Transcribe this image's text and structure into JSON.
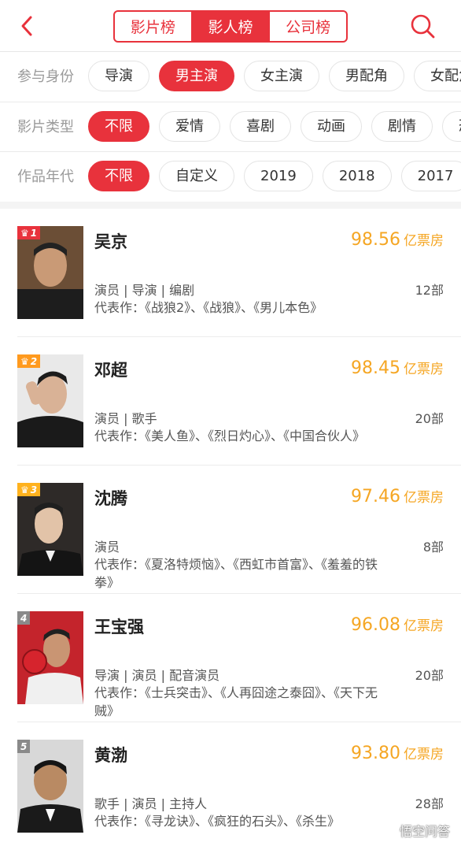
{
  "header": {
    "tabs": [
      {
        "label": "影片榜",
        "active": false
      },
      {
        "label": "影人榜",
        "active": true
      },
      {
        "label": "公司榜",
        "active": false
      }
    ]
  },
  "filters": [
    {
      "label": "参与身份",
      "options": [
        "导演",
        "男主演",
        "女主演",
        "男配角",
        "女配角"
      ],
      "selected": 1
    },
    {
      "label": "影片类型",
      "options": [
        "不限",
        "爱情",
        "喜剧",
        "动画",
        "剧情",
        "恐怖"
      ],
      "selected": 0
    },
    {
      "label": "作品年代",
      "options": [
        "不限",
        "自定义",
        "2019",
        "2018",
        "2017"
      ],
      "selected": 0
    }
  ],
  "list": [
    {
      "rank": "1",
      "name": "吴京",
      "score": "98.56",
      "unit": "亿票房",
      "roles": "演员 | 导演 | 编剧",
      "count": "12部",
      "works": "代表作：《战狼2》、《战狼》、《男儿本色》"
    },
    {
      "rank": "2",
      "name": "邓超",
      "score": "98.45",
      "unit": "亿票房",
      "roles": "演员 | 歌手",
      "count": "20部",
      "works": "代表作：《美人鱼》、《烈日灼心》、《中国合伙人》"
    },
    {
      "rank": "3",
      "name": "沈腾",
      "score": "97.46",
      "unit": "亿票房",
      "roles": "演员",
      "count": "8部",
      "works": "代表作：《夏洛特烦恼》、《西虹市首富》、《羞羞的铁拳》"
    },
    {
      "rank": "4",
      "name": "王宝强",
      "score": "96.08",
      "unit": "亿票房",
      "roles": "导演 | 演员 | 配音演员",
      "count": "20部",
      "works": "代表作：《士兵突击》、《人再囧途之泰囧》、《天下无贼》"
    },
    {
      "rank": "5",
      "name": "黄渤",
      "score": "93.80",
      "unit": "亿票房",
      "roles": "歌手 | 演员 | 主持人",
      "count": "28部",
      "works": "代表作：《寻龙诀》、《疯狂的石头》、《杀生》"
    }
  ],
  "watermark": "悟空问答",
  "colors": {
    "accent": "#e8323c",
    "score": "#f5a623"
  },
  "icons": {
    "back": "chevron-left-icon",
    "search": "search-icon",
    "crown": "crown-icon"
  }
}
